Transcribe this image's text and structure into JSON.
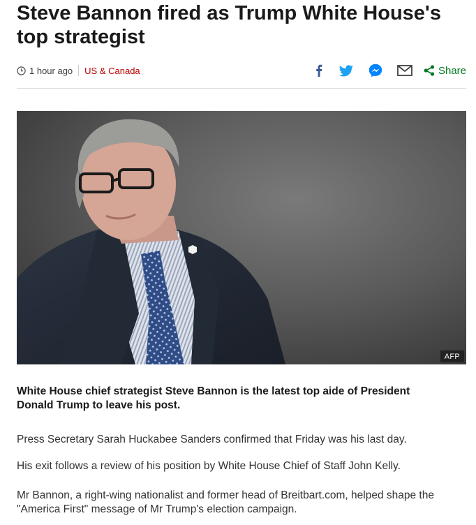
{
  "article": {
    "headline": "Steve Bannon fired as Trump White House's top strategist",
    "timestamp": "1 hour ago",
    "section": "US & Canada",
    "image_credit": "AFP",
    "intro": "White House chief strategist Steve Bannon is the latest top aide of President Donald Trump to leave his post.",
    "paragraphs": [
      "Press Secretary Sarah Huckabee Sanders confirmed that Friday was his last day.",
      "His exit follows a review of his position by White House Chief of Staff John Kelly.",
      "Mr Bannon, a right-wing nationalist and former head of Breitbart.com, helped shape the \"America First\" message of Mr Trump's election campaign."
    ]
  },
  "share": {
    "label": "Share",
    "icons": [
      "facebook-icon",
      "twitter-icon",
      "messenger-icon",
      "email-icon",
      "share-icon"
    ]
  },
  "colors": {
    "section_link": "#b80000",
    "share_label": "#037a22",
    "facebook": "#3b5998",
    "twitter": "#1da1f2",
    "messenger": "#0084ff",
    "email": "#404040"
  }
}
